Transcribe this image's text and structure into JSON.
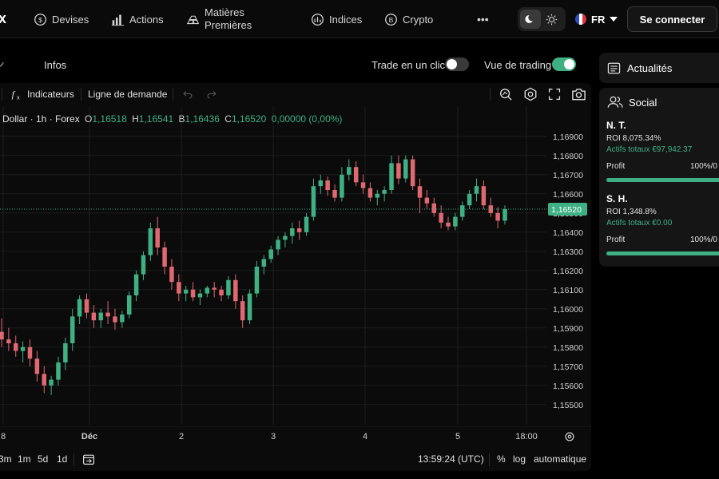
{
  "nav": {
    "logo": "x",
    "items": [
      {
        "label": "Devises",
        "icon": "currency-icon"
      },
      {
        "label": "Actions",
        "icon": "bar-chart-icon"
      },
      {
        "label_line1": "Matières",
        "label_line2": "Premières",
        "icon": "gold-bars-icon"
      },
      {
        "label": "Indices",
        "icon": "indices-icon"
      },
      {
        "label": "Crypto",
        "icon": "bitcoin-icon"
      }
    ],
    "more": "•••",
    "language": "FR",
    "connect_label": "Se connecter"
  },
  "subbar": {
    "infos": "Infos",
    "trade_one_click": "Trade en un clic",
    "trade_one_click_on": false,
    "trading_view": "Vue de trading",
    "trading_view_on": true
  },
  "toolbar": {
    "indicators": "Indicateurs",
    "demand_line": "Ligne de demande"
  },
  "legend": {
    "symbol": "Dollar · 1h · Forex",
    "o_label": "O",
    "o": "1,16518",
    "h_label": "H",
    "h": "1,16541",
    "b_label": "B",
    "b": "1,16436",
    "c_label": "C",
    "c": "1,16520",
    "change": "0,00000 (0,00%)"
  },
  "bottom": {
    "timeframes": [
      "3m",
      "1m",
      "5d",
      "1d"
    ],
    "clock": "13:59:24 (UTC)",
    "percent": "%",
    "log": "log",
    "auto": "automatique"
  },
  "sidebar": {
    "news": "Actualités",
    "social": "Social",
    "traders": [
      {
        "name": "N. T.",
        "roi": "ROI 8,075.34%",
        "assets": "Actifs totaux €97,942.37",
        "profit_label": "Profit",
        "profit_pct": "100%/0",
        "profit_fraction": 1.0
      },
      {
        "name": "S. H.",
        "roi": "ROI 1,348.8%",
        "assets": "Actifs totaux €0.00",
        "profit_label": "Profit",
        "profit_pct": "100%/0",
        "profit_fraction": 1.0
      }
    ]
  },
  "colors": {
    "up": "#3fb083",
    "down": "#e0686f",
    "accent": "#3fb083"
  },
  "chart_data": {
    "type": "candlestick",
    "x_tick_labels": [
      "8",
      "Déc",
      "2",
      "3",
      "4",
      "5",
      "18:00"
    ],
    "y_tick_labels": [
      "1,16900",
      "1,16800",
      "1,16700",
      "1,16600",
      "1,16500",
      "1,16400",
      "1,16300",
      "1,16200",
      "1,16100",
      "1,16000",
      "1,15900",
      "1,15800",
      "1,15700",
      "1,15600",
      "1,15500"
    ],
    "ylim": [
      1.1547,
      1.1697
    ],
    "last_price_label": "1,16520",
    "last_price": 1.1652,
    "candles": [
      [
        1.1588,
        1.1595,
        1.158,
        1.1584
      ],
      [
        1.1584,
        1.159,
        1.1578,
        1.1582
      ],
      [
        1.1582,
        1.1586,
        1.1575,
        1.1578
      ],
      [
        1.1578,
        1.1583,
        1.1572,
        1.158
      ],
      [
        1.158,
        1.1584,
        1.157,
        1.1574
      ],
      [
        1.1574,
        1.1578,
        1.1562,
        1.1566
      ],
      [
        1.1566,
        1.157,
        1.1556,
        1.156
      ],
      [
        1.156,
        1.1565,
        1.1555,
        1.1563
      ],
      [
        1.1563,
        1.1575,
        1.156,
        1.1572
      ],
      [
        1.1572,
        1.1585,
        1.1568,
        1.1582
      ],
      [
        1.1582,
        1.16,
        1.1578,
        1.1596
      ],
      [
        1.1596,
        1.1607,
        1.1592,
        1.1605
      ],
      [
        1.1605,
        1.1608,
        1.1595,
        1.1598
      ],
      [
        1.1598,
        1.1602,
        1.159,
        1.1594
      ],
      [
        1.1594,
        1.16,
        1.159,
        1.1598
      ],
      [
        1.1598,
        1.1604,
        1.1592,
        1.1596
      ],
      [
        1.1596,
        1.16,
        1.1589,
        1.1593
      ],
      [
        1.1593,
        1.1599,
        1.159,
        1.1597
      ],
      [
        1.1597,
        1.1609,
        1.1595,
        1.1607
      ],
      [
        1.1607,
        1.162,
        1.1604,
        1.1618
      ],
      [
        1.1618,
        1.163,
        1.1615,
        1.1628
      ],
      [
        1.1628,
        1.1645,
        1.1625,
        1.1642
      ],
      [
        1.1642,
        1.1648,
        1.1628,
        1.1632
      ],
      [
        1.1632,
        1.1635,
        1.1618,
        1.1622
      ],
      [
        1.1622,
        1.1626,
        1.161,
        1.1614
      ],
      [
        1.1614,
        1.1618,
        1.1604,
        1.1608
      ],
      [
        1.1608,
        1.1612,
        1.1604,
        1.161
      ],
      [
        1.161,
        1.1614,
        1.1604,
        1.1606
      ],
      [
        1.1606,
        1.161,
        1.1602,
        1.1608
      ],
      [
        1.1608,
        1.1612,
        1.1606,
        1.1611
      ],
      [
        1.1611,
        1.1614,
        1.1606,
        1.161
      ],
      [
        1.161,
        1.1612,
        1.1604,
        1.1607
      ],
      [
        1.1607,
        1.1617,
        1.1605,
        1.1615
      ],
      [
        1.1615,
        1.1618,
        1.16,
        1.1604
      ],
      [
        1.1604,
        1.1607,
        1.159,
        1.1594
      ],
      [
        1.1594,
        1.161,
        1.1592,
        1.1608
      ],
      [
        1.1608,
        1.1625,
        1.1606,
        1.1622
      ],
      [
        1.1622,
        1.1628,
        1.1618,
        1.1626
      ],
      [
        1.1626,
        1.1633,
        1.1624,
        1.1631
      ],
      [
        1.1631,
        1.1638,
        1.1628,
        1.1636
      ],
      [
        1.1636,
        1.164,
        1.1632,
        1.1638
      ],
      [
        1.1638,
        1.1645,
        1.1634,
        1.1642
      ],
      [
        1.1642,
        1.1646,
        1.1636,
        1.164
      ],
      [
        1.164,
        1.165,
        1.1638,
        1.1648
      ],
      [
        1.1648,
        1.1668,
        1.1646,
        1.1664
      ],
      [
        1.1664,
        1.167,
        1.166,
        1.1667
      ],
      [
        1.1667,
        1.1669,
        1.1659,
        1.1662
      ],
      [
        1.1662,
        1.1665,
        1.1656,
        1.1658
      ],
      [
        1.1658,
        1.1674,
        1.1656,
        1.167
      ],
      [
        1.167,
        1.1678,
        1.1667,
        1.1674
      ],
      [
        1.1674,
        1.1677,
        1.1664,
        1.1666
      ],
      [
        1.1666,
        1.167,
        1.166,
        1.1663
      ],
      [
        1.1663,
        1.1666,
        1.1656,
        1.1658
      ],
      [
        1.1658,
        1.1662,
        1.1654,
        1.166
      ],
      [
        1.166,
        1.1664,
        1.1656,
        1.1662
      ],
      [
        1.1662,
        1.168,
        1.166,
        1.1676
      ],
      [
        1.1676,
        1.168,
        1.1665,
        1.1668
      ],
      [
        1.1668,
        1.168,
        1.1666,
        1.1678
      ],
      [
        1.1678,
        1.168,
        1.1662,
        1.1664
      ],
      [
        1.1664,
        1.1668,
        1.165,
        1.1658
      ],
      [
        1.1658,
        1.1662,
        1.1652,
        1.1655
      ],
      [
        1.1655,
        1.1658,
        1.1648,
        1.165
      ],
      [
        1.165,
        1.1654,
        1.1642,
        1.1645
      ],
      [
        1.1645,
        1.1648,
        1.1641,
        1.1643
      ],
      [
        1.1643,
        1.165,
        1.1641,
        1.1648
      ],
      [
        1.1648,
        1.1656,
        1.1646,
        1.1654
      ],
      [
        1.1654,
        1.1662,
        1.1652,
        1.166
      ],
      [
        1.166,
        1.1668,
        1.1656,
        1.1664
      ],
      [
        1.1664,
        1.1667,
        1.1652,
        1.1654
      ],
      [
        1.1654,
        1.1658,
        1.1648,
        1.165
      ],
      [
        1.165,
        1.1653,
        1.1642,
        1.1646
      ],
      [
        1.1646,
        1.1654,
        1.1644,
        1.1652
      ]
    ]
  }
}
